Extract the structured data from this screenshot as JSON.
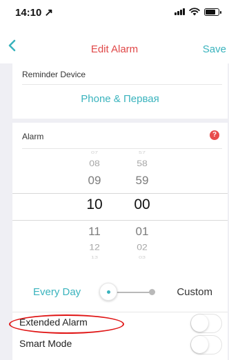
{
  "status": {
    "time": "14:10 ↗"
  },
  "nav": {
    "title": "Edit Alarm",
    "save": "Save"
  },
  "device": {
    "label": "Reminder Device",
    "value": "Phone & Первая"
  },
  "alarm": {
    "label": "Alarm",
    "help": "?",
    "hours": [
      "07",
      "08",
      "09",
      "10",
      "11",
      "12",
      "13"
    ],
    "minutes": [
      "57",
      "58",
      "59",
      "00",
      "01",
      "02",
      "03"
    ],
    "selected_hour": "10",
    "selected_minute": "00"
  },
  "repeat": {
    "left": "Every Day",
    "right": "Custom",
    "slider_position": 0
  },
  "options": [
    {
      "label": "Extended Alarm",
      "on": false
    },
    {
      "label": "Smart Mode",
      "on": false
    }
  ],
  "colors": {
    "accent": "#39b3bd",
    "title": "#e04848",
    "annotation": "#e01414"
  }
}
